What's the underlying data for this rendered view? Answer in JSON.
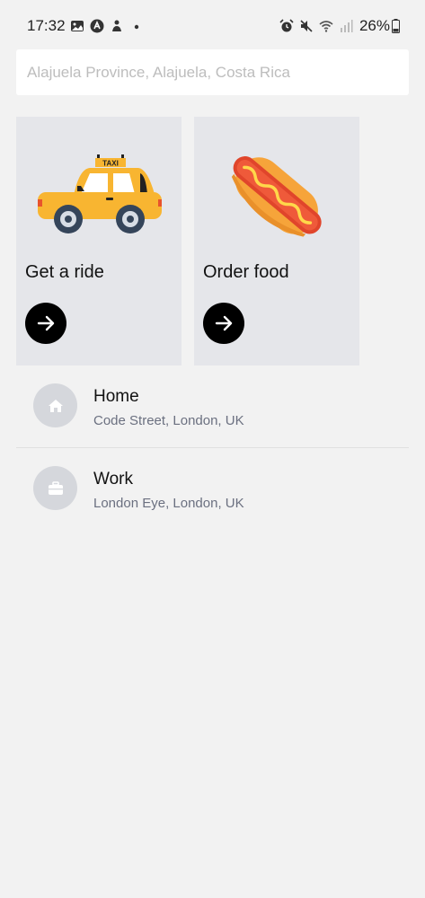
{
  "status_bar": {
    "time": "17:32",
    "battery": "26%",
    "left_icons": [
      "gallery-icon",
      "app-icon",
      "notification-icon",
      "dot-icon"
    ],
    "right_icons": [
      "alarm-icon",
      "mute-icon",
      "wifi-icon",
      "signal-icon"
    ]
  },
  "search": {
    "placeholder": "Alajuela Province, Alajuela, Costa Rica"
  },
  "cards": [
    {
      "label": "Get a ride",
      "icon": "taxi-icon",
      "action_icon": "arrow-right-icon"
    },
    {
      "label": "Order food",
      "icon": "hotdog-icon",
      "action_icon": "arrow-right-icon"
    }
  ],
  "taxi_sign": "TAXI",
  "saved_places": [
    {
      "title": "Home",
      "address": "Code Street, London, UK",
      "icon": "home-icon"
    },
    {
      "title": "Work",
      "address": "London Eye, London, UK",
      "icon": "briefcase-icon"
    }
  ],
  "colors": {
    "background": "#f2f2f2",
    "card": "#e5e6ea",
    "taxi": "#f8b531",
    "arrow_button": "#000000",
    "place_icon_bg": "#d5d7dc"
  }
}
